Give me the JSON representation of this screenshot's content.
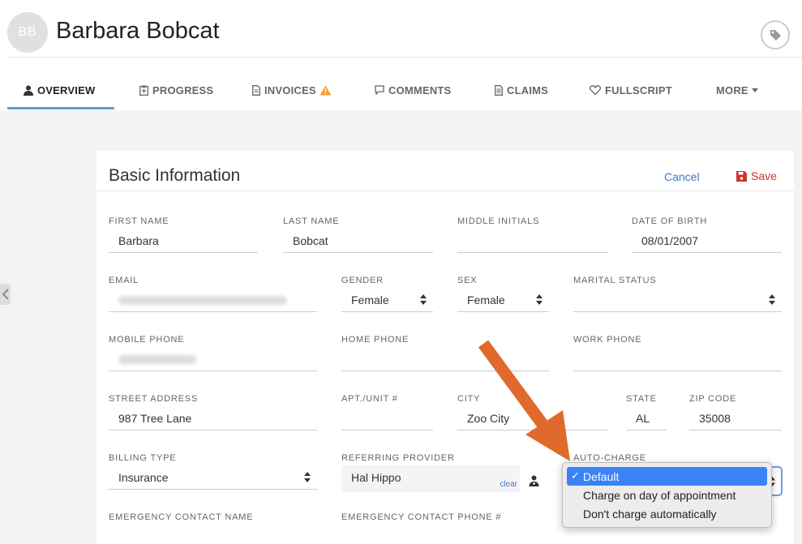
{
  "header": {
    "avatar_initials": "BB",
    "patient_name": "Barbara Bobcat"
  },
  "tabs": [
    {
      "label": "OVERVIEW",
      "icon": "user-icon",
      "active": true
    },
    {
      "label": "PROGRESS",
      "icon": "clipboard-icon"
    },
    {
      "label": "INVOICES",
      "icon": "document-icon",
      "badge": "warning-icon"
    },
    {
      "label": "COMMENTS",
      "icon": "comment-icon"
    },
    {
      "label": "CLAIMS",
      "icon": "file-icon"
    },
    {
      "label": "FULLSCRIPT",
      "icon": "heart-icon"
    },
    {
      "label": "MORE",
      "icon": "caret-down-icon"
    }
  ],
  "form": {
    "title": "Basic Information",
    "cancel_label": "Cancel",
    "save_label": "Save",
    "fields": {
      "first_name": {
        "label": "FIRST NAME",
        "value": "Barbara"
      },
      "last_name": {
        "label": "LAST NAME",
        "value": "Bobcat"
      },
      "middle_initials": {
        "label": "MIDDLE INITIALS",
        "value": ""
      },
      "date_of_birth": {
        "label": "DATE OF BIRTH",
        "value": "08/01/2007"
      },
      "email": {
        "label": "EMAIL",
        "value": ""
      },
      "gender": {
        "label": "GENDER",
        "value": "Female"
      },
      "sex": {
        "label": "SEX",
        "value": "Female"
      },
      "marital_status": {
        "label": "MARITAL STATUS",
        "value": ""
      },
      "mobile_phone": {
        "label": "MOBILE PHONE",
        "value": ""
      },
      "home_phone": {
        "label": "HOME PHONE",
        "value": ""
      },
      "work_phone": {
        "label": "WORK PHONE",
        "value": ""
      },
      "street_address": {
        "label": "STREET ADDRESS",
        "value": "987 Tree Lane"
      },
      "apt_unit": {
        "label": "APT./UNIT #",
        "value": ""
      },
      "city": {
        "label": "CITY",
        "value": "Zoo City"
      },
      "state": {
        "label": "STATE",
        "value": "AL"
      },
      "zip_code": {
        "label": "ZIP CODE",
        "value": "35008"
      },
      "billing_type": {
        "label": "BILLING TYPE",
        "value": "Insurance"
      },
      "referring_provider": {
        "label": "REFERRING PROVIDER",
        "value": "Hal Hippo",
        "clear_label": "clear"
      },
      "auto_charge": {
        "label": "AUTO-CHARGE"
      },
      "emergency_contact_name": {
        "label": "EMERGENCY CONTACT NAME"
      },
      "emergency_contact_phone": {
        "label": "EMERGENCY CONTACT PHONE #"
      }
    }
  },
  "auto_charge_dropdown": {
    "check": "✓",
    "options": [
      "Default",
      "Charge on day of appointment",
      "Don't charge automatically"
    ],
    "selected": "Default"
  },
  "colors": {
    "accent": "#5b9bd5",
    "link": "#3a7bbf",
    "save": "#d0312d",
    "annotation_arrow": "#e06a2c",
    "dropdown_highlight": "#3b82f6"
  }
}
